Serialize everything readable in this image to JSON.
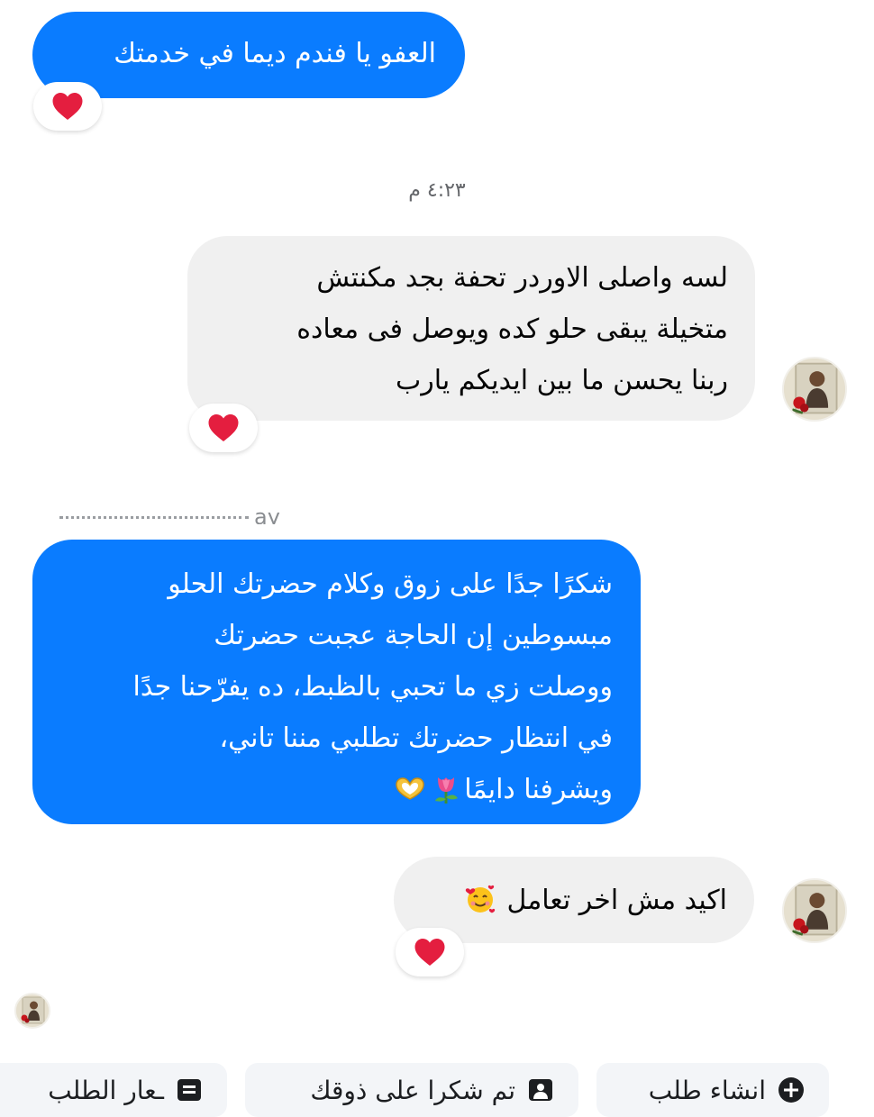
{
  "messages": [
    {
      "direction": "outgoing",
      "lines": [
        "العفو يا فندم ديما في خدمتك"
      ],
      "reaction": "heart"
    },
    {
      "direction": "incoming",
      "lines": [
        "لسه واصلى الاوردر تحفة بجد مكنتش",
        "متخيلة يبقى حلو كده ويوصل فى معاده",
        "ربنا يحسن ما بين ايديكم يارب"
      ],
      "reaction": "heart"
    },
    {
      "direction": "outgoing",
      "lines": [
        "شكرًا جدًا على زوق وكلام حضرتك الحلو",
        "مبسوطين إن الحاجة عجبت حضرتك",
        "ووصلت زي ما تحبي بالظبط، ده يفرّحنا جدًا",
        "في انتظار حضرتك تطلبي مننا تاني،",
        "ويشرفنا دايمًا"
      ],
      "emojis": [
        "tulip",
        "heart-hands"
      ]
    },
    {
      "direction": "incoming",
      "lines": [
        "اكيد مش اخر تعامل"
      ],
      "emojis": [
        "smiling-face-with-hearts"
      ],
      "reaction": "heart"
    }
  ],
  "timestamp": "٤:٢٣ م",
  "reply_label": "ay",
  "quick_replies": [
    {
      "label": "ـعار الطلب",
      "icon": "receipt-icon"
    },
    {
      "label": "تم شكرا على ذوقك",
      "icon": "message-icon"
    },
    {
      "label": "انشاء طلب",
      "icon": "plus-circle-icon"
    }
  ],
  "colors": {
    "outgoing_bubble": "#0a7cff",
    "incoming_bubble": "#f0f0f0",
    "reaction_heart": "#e41e3f",
    "timestamp_text": "#65676b"
  }
}
